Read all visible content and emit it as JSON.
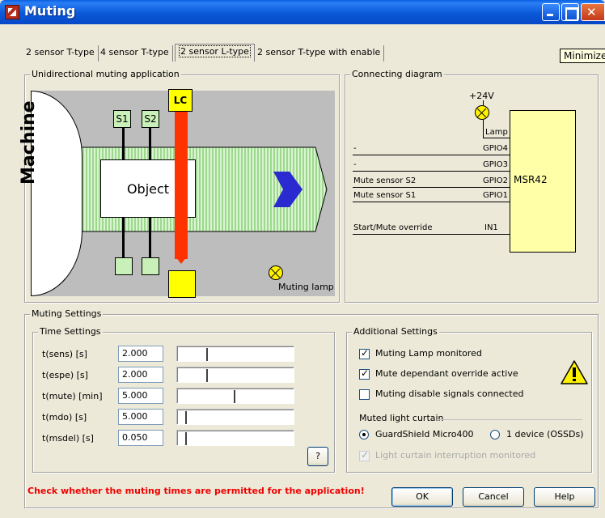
{
  "window": {
    "title": "Muting",
    "tooltip": "Minimize"
  },
  "tabs": [
    {
      "label": "2 sensor T-type"
    },
    {
      "label": "4 sensor T-type"
    },
    {
      "label": "2 sensor L-type",
      "active": true
    },
    {
      "label": "2 sensor T-type with enable"
    }
  ],
  "application": {
    "group_label": "Unidirectional muting application",
    "machine_label": "Machine",
    "object_label": "Object",
    "sensor1": "S1",
    "sensor2": "S2",
    "light_curtain": "LC",
    "lamp_label": "Muting lamp"
  },
  "diagram": {
    "group_label": "Connecting diagram",
    "supply": "+24V",
    "lamp": "Lamp",
    "device": "MSR42",
    "rows": [
      {
        "signal": "-",
        "pin": "GPIO4"
      },
      {
        "signal": "-",
        "pin": "GPIO3"
      },
      {
        "signal": "Mute sensor S2",
        "pin": "GPIO2"
      },
      {
        "signal": "Mute sensor S1",
        "pin": "GPIO1"
      },
      {
        "signal": "Start/Mute override",
        "pin": "IN1"
      }
    ]
  },
  "muting_settings": {
    "group_label": "Muting Settings",
    "time": {
      "group_label": "Time Settings",
      "rows": [
        {
          "label": "t(sens) [s]",
          "value": "2.000",
          "slider_fraction": 0.22
        },
        {
          "label": "t(espe) [s]",
          "value": "2.000",
          "slider_fraction": 0.22
        },
        {
          "label": "t(mute) [min]",
          "value": "5.000",
          "slider_fraction": 0.47
        },
        {
          "label": "t(mdo) [s]",
          "value": "5.000",
          "slider_fraction": 0.02
        },
        {
          "label": "t(msdel) [s]",
          "value": "0.050",
          "slider_fraction": 0.02
        }
      ],
      "help_label": "?"
    },
    "additional": {
      "group_label": "Additional Settings",
      "checks": [
        {
          "label": "Muting Lamp monitored",
          "checked": true
        },
        {
          "label": "Mute dependant override active",
          "checked": true
        },
        {
          "label": "Muting disable signals connected",
          "checked": false
        }
      ],
      "curtain_label": "Muted light curtain",
      "radios": [
        {
          "label": "GuardShield Micro400",
          "checked": true
        },
        {
          "label": "1 device (OSSDs)",
          "checked": false
        }
      ],
      "interruption": {
        "label": "Light curtain interruption monitored",
        "checked": true,
        "disabled": true
      }
    }
  },
  "footer": {
    "warning": "Check whether the muting times are permitted for the application!",
    "ok": "OK",
    "cancel": "Cancel",
    "help": "Help"
  },
  "colors": {
    "warning_text": "#F00000",
    "light_curtain": "#FF3300",
    "lc_box": "#FFFF00",
    "sensor": "#C8F0B8",
    "device_box": "#FFFFA8",
    "conveyor_arrow": "#2A2AD0"
  }
}
